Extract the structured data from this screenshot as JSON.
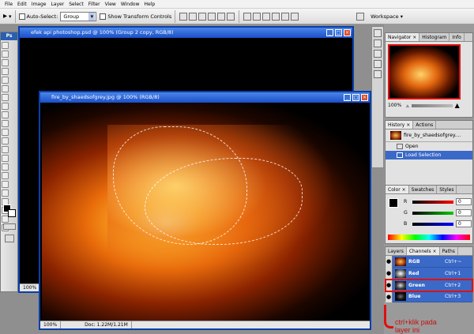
{
  "menu": [
    "File",
    "Edit",
    "Image",
    "Layer",
    "Select",
    "Filter",
    "View",
    "Window",
    "Help"
  ],
  "options": {
    "auto_select_label": "Auto-Select:",
    "auto_select_value": "Group",
    "show_transform_label": "Show Transform Controls",
    "workspace_label": "Workspace ▾"
  },
  "toolbox": {
    "logo": "Ps"
  },
  "doc_back": {
    "title": "efek api photoshop.psd @ 100% (Group 2 copy, RGB/8)",
    "zoom": "100%"
  },
  "doc_front": {
    "title": "fire_by_shaedsofgrey.jpg @ 100% (RGB/8)",
    "zoom": "100%",
    "doc_size": "Doc: 1.22M/1.21M"
  },
  "navigator": {
    "tabs": [
      "Navigator ×",
      "Histogram",
      "Info"
    ],
    "zoom": "100%"
  },
  "history": {
    "tabs": [
      "History ×",
      "Actions"
    ],
    "snapshot": "fire_by_shaedsofgrey....",
    "items": [
      "Open",
      "Load Selection"
    ]
  },
  "color": {
    "tabs": [
      "Color ×",
      "Swatches",
      "Styles"
    ],
    "channels": [
      {
        "label": "R",
        "value": "0"
      },
      {
        "label": "G",
        "value": "0"
      },
      {
        "label": "B",
        "value": "0"
      }
    ]
  },
  "channels": {
    "tabs": [
      "Layers",
      "Channels ×",
      "Paths"
    ],
    "rows": [
      {
        "name": "RGB",
        "shortcut": "Ctrl+~"
      },
      {
        "name": "Red",
        "shortcut": "Ctrl+1"
      },
      {
        "name": "Green",
        "shortcut": "Ctrl+2"
      },
      {
        "name": "Blue",
        "shortcut": "Ctrl+3"
      }
    ]
  },
  "annotation": {
    "line1": "ctrl+klik pada",
    "line2": "layer ini"
  },
  "colors": {
    "accent": "#1a4fc8",
    "highlight": "#e01010"
  }
}
